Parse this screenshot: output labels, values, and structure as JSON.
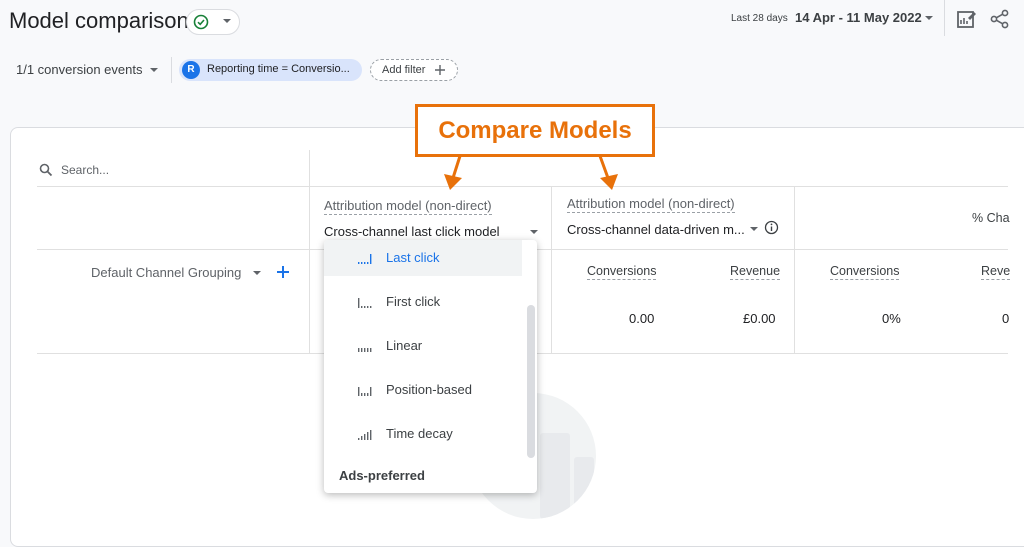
{
  "header": {
    "title": "Model comparison",
    "date_small": "Last 28 days",
    "date_range": "14 Apr - 11 May 2022"
  },
  "filters": {
    "conversion_events": "1/1 conversion events",
    "chip_letter": "R",
    "chip_text": "Reporting time = Conversio...",
    "add_filter": "Add filter"
  },
  "search": {
    "placeholder": "Search..."
  },
  "table": {
    "model_a": {
      "label": "Attribution model (non-direct)",
      "value": "Cross-channel last click model"
    },
    "model_b": {
      "label": "Attribution model (non-direct)",
      "value": "Cross-channel data-driven m..."
    },
    "change_header": "% Cha",
    "dimension": "Default Channel Grouping",
    "columns": {
      "b_conversions": "Conversions",
      "b_revenue": "Revenue",
      "c_conversions": "Conversions",
      "c_revenue": "Reve"
    },
    "row": {
      "b_conversions": "0.00",
      "b_revenue": "£0.00",
      "c_conversions": "0%",
      "c_revenue": "0"
    }
  },
  "callout": {
    "text": "Compare Models"
  },
  "dropdown": {
    "items": [
      {
        "label": "Last click",
        "selected": true
      },
      {
        "label": "First click",
        "selected": false
      },
      {
        "label": "Linear",
        "selected": false
      },
      {
        "label": "Position-based",
        "selected": false
      },
      {
        "label": "Time decay",
        "selected": false
      }
    ],
    "section": "Ads-preferred"
  },
  "colors": {
    "accent": "#1a73e8",
    "callout": "#e8710a",
    "success": "#188038"
  }
}
